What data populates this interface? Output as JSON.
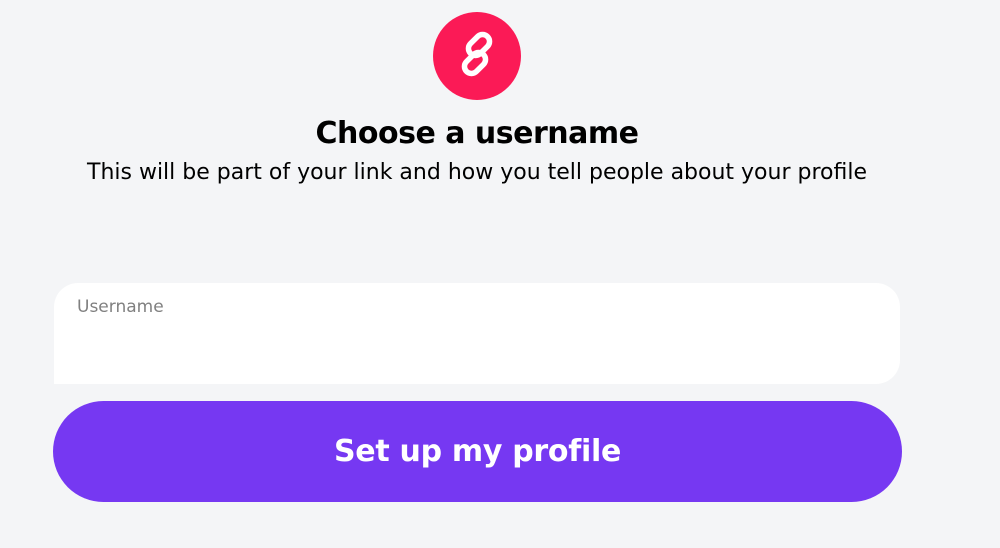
{
  "logo": {
    "icon": "link-icon",
    "color": "#fb1a56"
  },
  "header": {
    "title": "Choose a username",
    "subtitle": "This will be part of your link and how you tell people about your profile"
  },
  "form": {
    "username": {
      "label": "Username",
      "value": ""
    },
    "submit_label": "Set up my profile",
    "submit_color": "#7638f2"
  }
}
